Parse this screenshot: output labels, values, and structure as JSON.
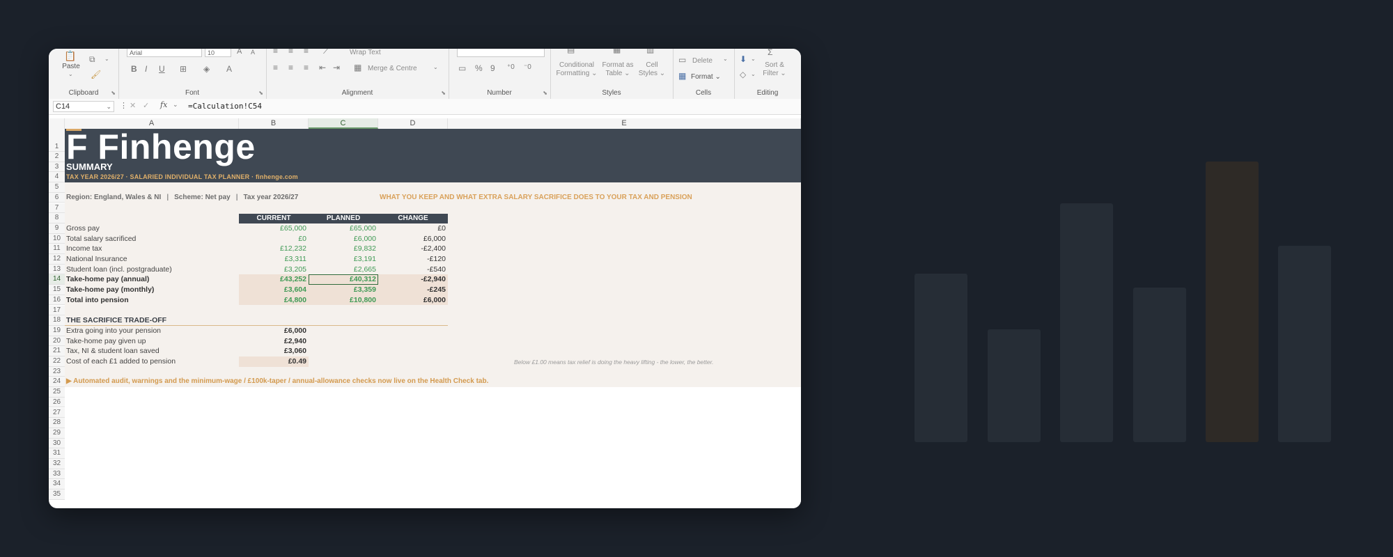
{
  "background": {
    "bar_count": 6
  },
  "ribbon": {
    "clipboard": {
      "label": "Clipboard",
      "paste": "Paste"
    },
    "font": {
      "label": "Font",
      "font_name": "Arial",
      "font_size": "10",
      "bold": "B",
      "italic": "I",
      "underline": "U"
    },
    "alignment": {
      "label": "Alignment",
      "wrap_text": "Wrap Text",
      "merge_centre": "Merge & Centre"
    },
    "number": {
      "label": "Number",
      "percent": "%",
      "comma": "9"
    },
    "styles": {
      "label": "Styles",
      "conditional_formatting": [
        "Conditional",
        "Formatting ⌄"
      ],
      "format_as_table": [
        "Format as",
        "Table ⌄"
      ],
      "cell_styles": [
        "Cell",
        "Styles ⌄"
      ]
    },
    "cells": {
      "label": "Cells",
      "delete": "Delete",
      "format": "Format ⌄"
    },
    "editing": {
      "label": "Editing",
      "sort_filter": [
        "Sort &",
        "Filter ⌄"
      ]
    }
  },
  "formula_bar": {
    "name_box": "C14",
    "fx": "fx",
    "formula": "=Calculation!C54"
  },
  "columns": [
    "A",
    "B",
    "C",
    "D",
    "E"
  ],
  "rows": [
    "1",
    "2",
    "3",
    "4",
    "5",
    "6",
    "7",
    "8",
    "9",
    "10",
    "11",
    "12",
    "13",
    "14",
    "15",
    "16",
    "17",
    "18",
    "19",
    "20",
    "21",
    "22",
    "23",
    "24",
    "25",
    "26",
    "27",
    "28",
    "29",
    "30",
    "31",
    "32",
    "33",
    "34",
    "35"
  ],
  "header": {
    "logo": "F Finhenge",
    "title": "SUMMARY",
    "subtitle": "TAX YEAR 2026/27  ·  SALARIED INDIVIDUAL TAX PLANNER · finhenge.com"
  },
  "info": {
    "region": "Region: England, Wales & NI",
    "scheme": "Scheme: Net pay",
    "tax_year": "Tax year 2026/27",
    "separator": "|",
    "headline": "WHAT YOU KEEP AND WHAT EXTRA SALARY SACRIFICE DOES TO YOUR TAX AND PENSION"
  },
  "table": {
    "headers": [
      "CURRENT",
      "PLANNED",
      "CHANGE"
    ],
    "rows": [
      {
        "label": "Gross pay",
        "current": "£65,000",
        "planned": "£65,000",
        "change": "£0"
      },
      {
        "label": "Total salary sacrificed",
        "current": "£0",
        "planned": "£6,000",
        "change": "£6,000"
      },
      {
        "label": "Income tax",
        "current": "£12,232",
        "planned": "£9,832",
        "change": "-£2,400"
      },
      {
        "label": "National Insurance",
        "current": "£3,311",
        "planned": "£3,191",
        "change": "-£120"
      },
      {
        "label": "Student loan (incl. postgraduate)",
        "current": "£3,205",
        "planned": "£2,665",
        "change": "-£540"
      },
      {
        "label": "Take-home pay (annual)",
        "current": "£43,252",
        "planned": "£40,312",
        "change": "-£2,940"
      },
      {
        "label": "Take-home pay (monthly)",
        "current": "£3,604",
        "planned": "£3,359",
        "change": "-£245"
      },
      {
        "label": "Total into pension",
        "current": "£4,800",
        "planned": "£10,800",
        "change": "£6,000"
      }
    ]
  },
  "tradeoff": {
    "title": "THE SACRIFICE TRADE-OFF",
    "rows": [
      {
        "label": "Extra going into your pension",
        "value": "£6,000"
      },
      {
        "label": "Take-home pay given up",
        "value": "£2,940"
      },
      {
        "label": "Tax, NI & student loan saved",
        "value": "£3,060"
      },
      {
        "label": "Cost of each £1 added to pension",
        "value": "£0.49"
      }
    ],
    "note": "Below £1.00 means tax relief is doing the heavy lifting - the lower, the better."
  },
  "banner": "▶  Automated audit, warnings and the minimum-wage / £100k-taper / annual-allowance checks now live on the Health Check tab.",
  "selected_cell": "C14"
}
